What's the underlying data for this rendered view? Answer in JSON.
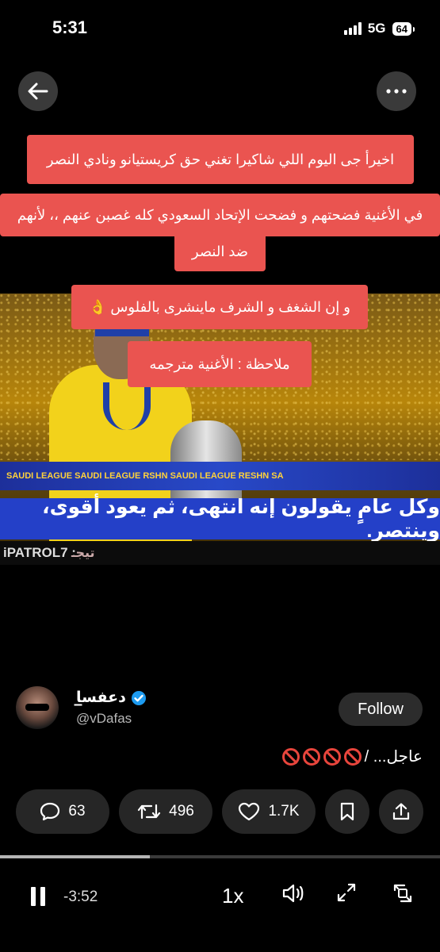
{
  "status_bar": {
    "time": "5:31",
    "network": "5G",
    "battery": "64"
  },
  "video": {
    "overlay_bubbles": [
      "اخيرأ جى اليوم اللي شاكيرا تغني حق كريستيانو ونادي النصر",
      "في الأغنية فضحتهم و فضحت الإتحاد السعودي كله غصبن عنهم ،، لأنهم",
      "ضد النصر",
      "و إن الشغف و الشرف ماينشرى بالفلوس 👌",
      "ملاحظة : الأغنية مترجمه"
    ],
    "caption": "وكل عامٍ يقولون إنه انتهى، ثم يعود أقوى، وينتصر.",
    "credit": "iPATROL7 :",
    "credit_arabic": "تيجـ",
    "board_text": "SAUDI LEAGUE   SAUDI LEAGUE   RSHN SAUDI LEAGUE   RESHN SA"
  },
  "tweet": {
    "display_name": "دعفس̲̲̲̲̲̲̲̲̲̲̲̲̲̲ا",
    "handle": "@vDafas",
    "follow_label": "Follow",
    "text": "عاجل... /",
    "replies": "63",
    "retweets": "496",
    "likes": "1.7K"
  },
  "player": {
    "remaining": "-3:52",
    "speed": "1x",
    "progress": 0.34
  },
  "colors": {
    "bubble": "#ea5450",
    "caption_band": "#2440c8",
    "verified": "#1d9bf0",
    "ban": "#e8453c"
  }
}
